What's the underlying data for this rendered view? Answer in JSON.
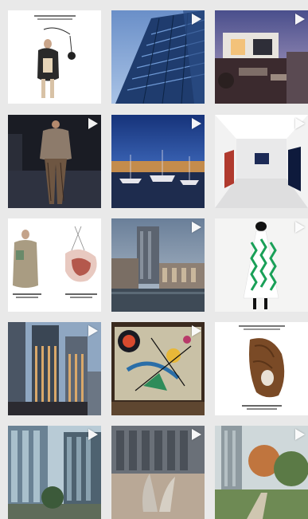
{
  "feed": {
    "tiles": [
      {
        "id": "t1",
        "kind": "fashion-white",
        "reel": false
      },
      {
        "id": "t2",
        "kind": "glass-tower",
        "reel": true
      },
      {
        "id": "t3",
        "kind": "house-dusk",
        "reel": true
      },
      {
        "id": "t4",
        "kind": "runway",
        "reel": true
      },
      {
        "id": "t5",
        "kind": "marina-night",
        "reel": true
      },
      {
        "id": "t6",
        "kind": "gallery-white",
        "reel": true
      },
      {
        "id": "t7",
        "kind": "garment-pair",
        "reel": false
      },
      {
        "id": "t8",
        "kind": "city-river",
        "reel": true
      },
      {
        "id": "t9",
        "kind": "green-dress",
        "reel": true
      },
      {
        "id": "t10",
        "kind": "towers-dusk",
        "reel": true
      },
      {
        "id": "t11",
        "kind": "abstract-painting",
        "reel": true
      },
      {
        "id": "t12",
        "kind": "brown-sculpture",
        "reel": false
      },
      {
        "id": "t13",
        "kind": "glass-street",
        "reel": true
      },
      {
        "id": "t14",
        "kind": "plaza-sculpture",
        "reel": true
      },
      {
        "id": "t15",
        "kind": "garden-tower",
        "reel": true
      }
    ]
  },
  "icons": {
    "reel": "play-triangle-icon"
  },
  "colors": {
    "background": "#e9e9e9",
    "reel_icon": "#ffffff"
  }
}
